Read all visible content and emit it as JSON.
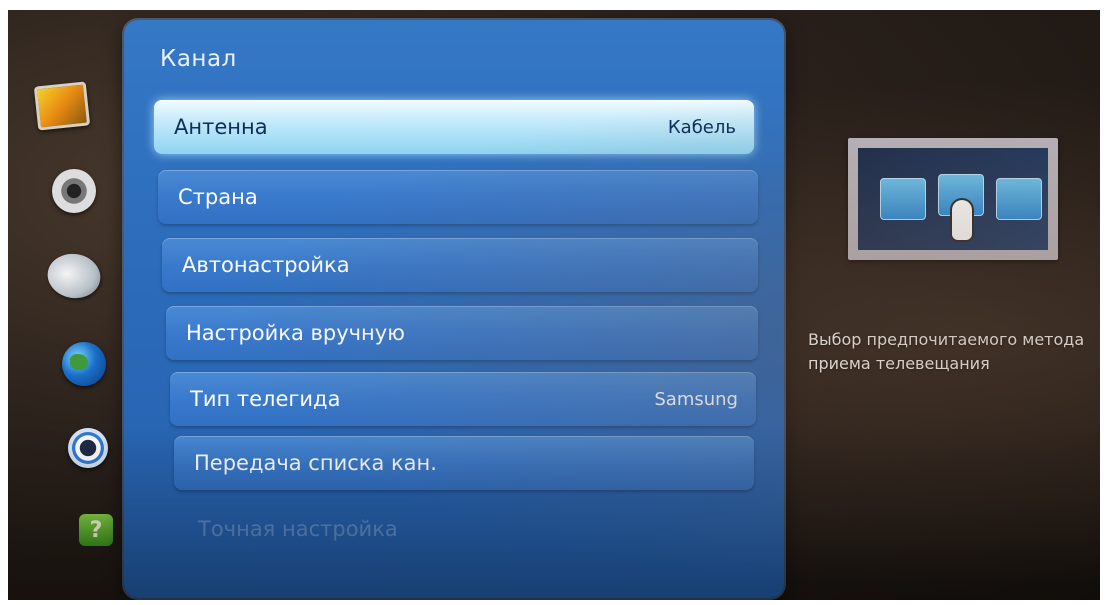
{
  "panel": {
    "title": "Канал"
  },
  "menu": {
    "items": [
      {
        "label": "Антенна",
        "value": "Кабель",
        "state": "selected"
      },
      {
        "label": "Страна",
        "value": "",
        "state": "normal"
      },
      {
        "label": "Автонастройка",
        "value": "",
        "state": "normal"
      },
      {
        "label": "Настройка вручную",
        "value": "",
        "state": "normal"
      },
      {
        "label": "Тип телегида",
        "value": "Samsung",
        "state": "normal"
      },
      {
        "label": "Передача списка кан.",
        "value": "",
        "state": "normal"
      },
      {
        "label": "Точная настройка",
        "value": "",
        "state": "disabled"
      }
    ]
  },
  "sidebar": {
    "icons": [
      "picture-icon",
      "sound-icon",
      "channel-icon",
      "network-icon",
      "system-icon",
      "support-icon"
    ],
    "support_glyph": "?"
  },
  "info": {
    "description": "Выбор предпочитаемого метода приема телевещания"
  },
  "colors": {
    "panel": "#2c6cbb",
    "selected": "#c8ecfb",
    "text": "#ffffff"
  }
}
